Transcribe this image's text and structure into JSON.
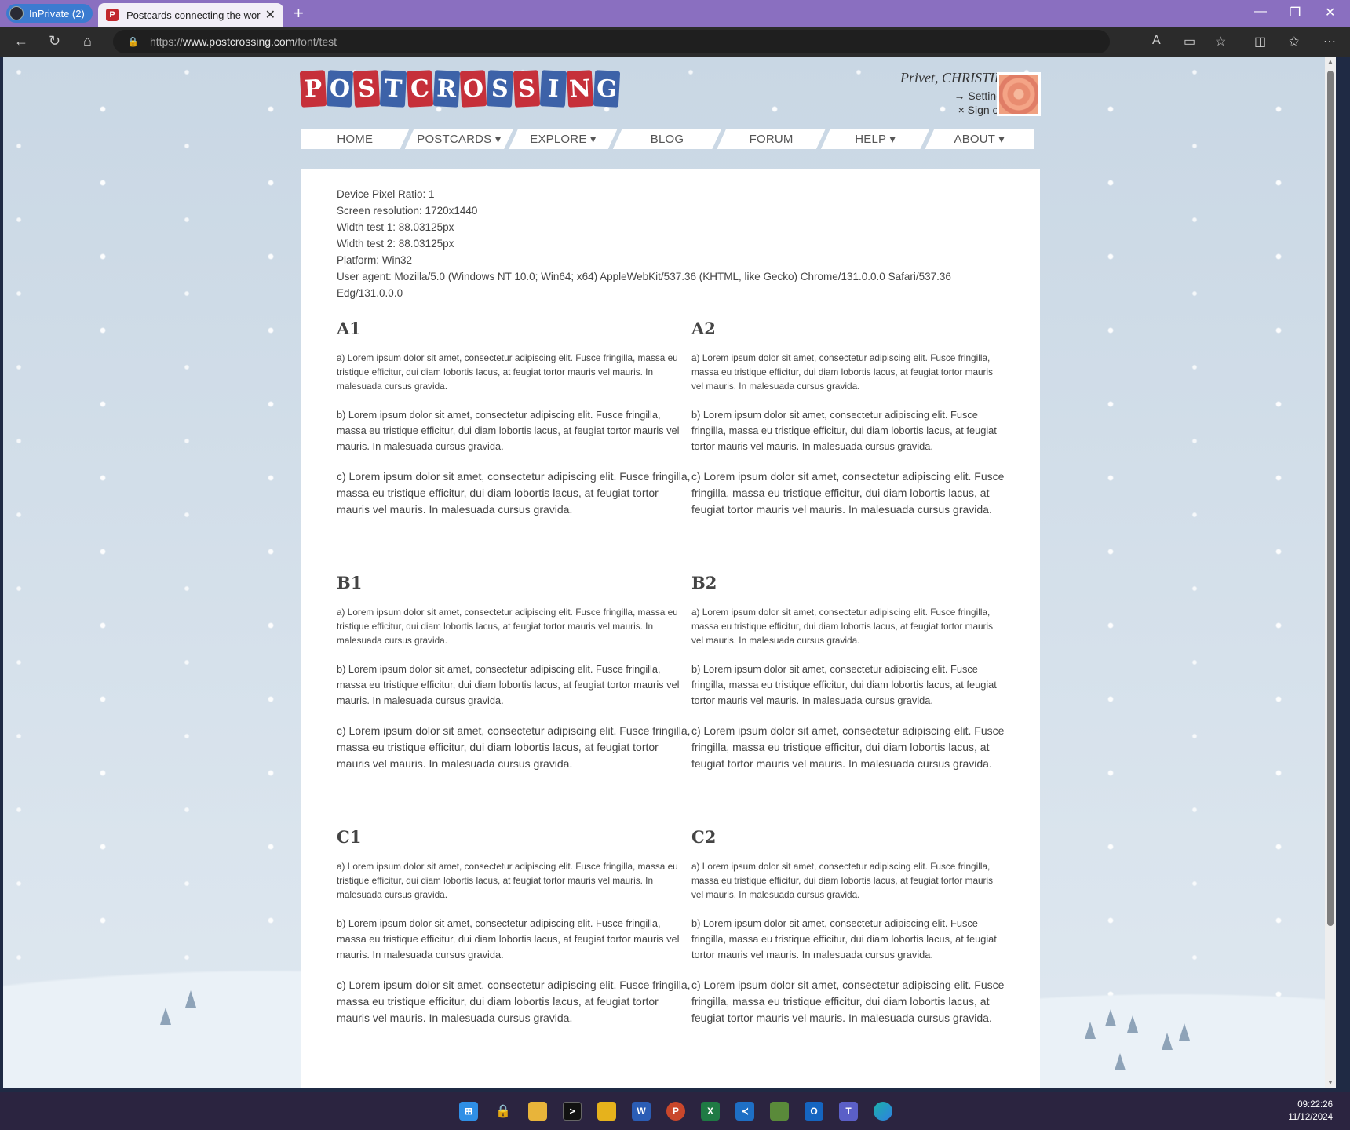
{
  "browser": {
    "inprivate_label": "InPrivate (2)",
    "tab_title": "Postcards connecting the world -",
    "url_prefix": "https://",
    "url_domain": "www.postcrossing.com",
    "url_path": "/font/test"
  },
  "site": {
    "logo_letters": [
      "P",
      "O",
      "S",
      "T",
      "C",
      "R",
      "O",
      "S",
      "S",
      "I",
      "N",
      "G"
    ],
    "greeting": "Privet, CHRISTIE!",
    "settings_link": "→ Settings",
    "signout_link": "× Sign out",
    "menu": [
      {
        "label": "HOME"
      },
      {
        "label": "POSTCARDS ▾"
      },
      {
        "label": "EXPLORE ▾"
      },
      {
        "label": "BLOG"
      },
      {
        "label": "FORUM"
      },
      {
        "label": "HELP ▾"
      },
      {
        "label": "ABOUT ▾"
      }
    ]
  },
  "info": {
    "dpr": "Device Pixel Ratio: 1",
    "resolution": "Screen resolution: 1720x1440",
    "width1": "Width test 1: 88.03125px",
    "width2": "Width test 2: 88.03125px",
    "platform": "Platform: Win32",
    "ua": "User agent: Mozilla/5.0 (Windows NT 10.0; Win64; x64) AppleWebKit/537.36 (KHTML, like Gecko) Chrome/131.0.0.0 Safari/537.36 Edg/131.0.0.0"
  },
  "sections": {
    "a1": {
      "title": "A1"
    },
    "a2": {
      "title": "A2"
    },
    "b1": {
      "title": "B1"
    },
    "b2": {
      "title": "B2"
    },
    "c1": {
      "title": "C1"
    },
    "c2": {
      "title": "C2"
    }
  },
  "lorem": {
    "a": "a) Lorem ipsum dolor sit amet, consectetur adipiscing elit. Fusce fringilla, massa eu tristique efficitur, dui diam lobortis lacus, at feugiat tortor mauris vel mauris. In malesuada cursus gravida.",
    "b": "b) Lorem ipsum dolor sit amet, consectetur adipiscing elit. Fusce fringilla, massa eu tristique efficitur, dui diam lobortis lacus, at feugiat tortor mauris vel mauris. In malesuada cursus gravida.",
    "c": "c) Lorem ipsum dolor sit amet, consectetur adipiscing elit. Fusce fringilla, massa eu tristique efficitur, dui diam lobortis lacus, at feugiat tortor mauris vel mauris. In malesuada cursus gravida."
  },
  "clock": {
    "time": "09:22:26",
    "date": "11/12/2024"
  },
  "colors": {
    "titlebar": "#8a6fc0",
    "logo_red": "#c6303a",
    "logo_blue": "#3d62a8",
    "page_bg": "#cfdbe6"
  }
}
